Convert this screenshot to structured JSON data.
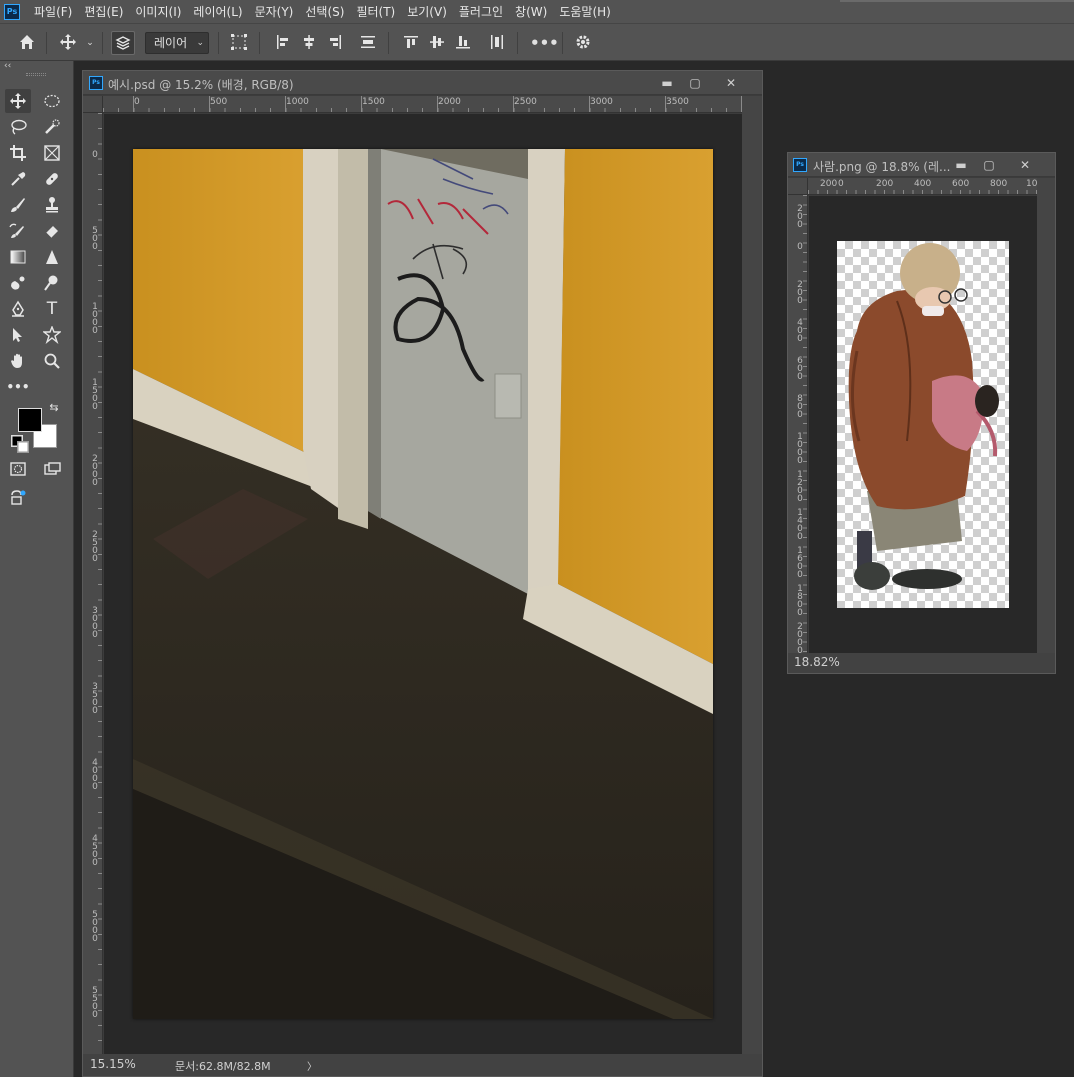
{
  "app": {
    "logo": "Ps"
  },
  "menu": [
    "파일(F)",
    "편집(E)",
    "이미지(I)",
    "레이어(L)",
    "문자(Y)",
    "선택(S)",
    "필터(T)",
    "보기(V)",
    "플러그인",
    "창(W)",
    "도움말(H)"
  ],
  "options_bar": {
    "layer_select": "레이어",
    "icons": [
      "home-icon",
      "move-icon",
      "chevron-down-icon",
      "layer-stack-icon",
      "transform-controls-icon",
      "align-left-icon",
      "align-hcenter-icon",
      "align-right-icon",
      "distribute-icon",
      "align-top-icon",
      "align-vcenter-icon",
      "align-bottom-icon",
      "distribute-v-icon",
      "more-icon",
      "settings-icon"
    ]
  },
  "toolbar": {
    "collapse_label": "‹‹",
    "tools": [
      "move-tool",
      "ellipse-marquee-tool",
      "lasso-tool",
      "quick-select-tool",
      "crop-tool",
      "frame-tool",
      "eyedropper-tool",
      "healing-brush-tool",
      "brush-tool",
      "clone-stamp-tool",
      "history-brush-tool",
      "eraser-tool",
      "gradient-tool",
      "blur-tool",
      "dodge-tool",
      "burn-tool",
      "pen-tool",
      "type-tool",
      "path-select-tool",
      "custom-shape-tool",
      "hand-tool",
      "zoom-tool",
      "more-tools"
    ],
    "foreground_color": "#000000",
    "background_color": "#ffffff"
  },
  "document1": {
    "title": "예시.psd @ 15.2% (배경, RGB/8)",
    "ruler_h": [
      "0",
      "500",
      "1000",
      "1500",
      "2000",
      "2500",
      "3000",
      "3500"
    ],
    "ruler_v": [
      "0",
      "500",
      "1000",
      "1500",
      "2000",
      "2500",
      "3000",
      "3500",
      "4000",
      "4500",
      "5000",
      "5500"
    ],
    "zoom": "15.15%",
    "doc_info": "문서:62.8M/82.8M",
    "status_arrow": "〉"
  },
  "document2": {
    "title": "사람.png @ 18.8% (레...",
    "ruler_h": [
      "200",
      "0",
      "200",
      "400",
      "600",
      "800",
      "10"
    ],
    "ruler_v": [
      "200",
      "0",
      "200",
      "400",
      "600",
      "800",
      "1000",
      "1200",
      "1400",
      "1600",
      "1800",
      "2000"
    ],
    "zoom": "18.82%"
  },
  "window_buttons": {
    "minimize": "▬",
    "restore": "▢",
    "close": "✕"
  }
}
